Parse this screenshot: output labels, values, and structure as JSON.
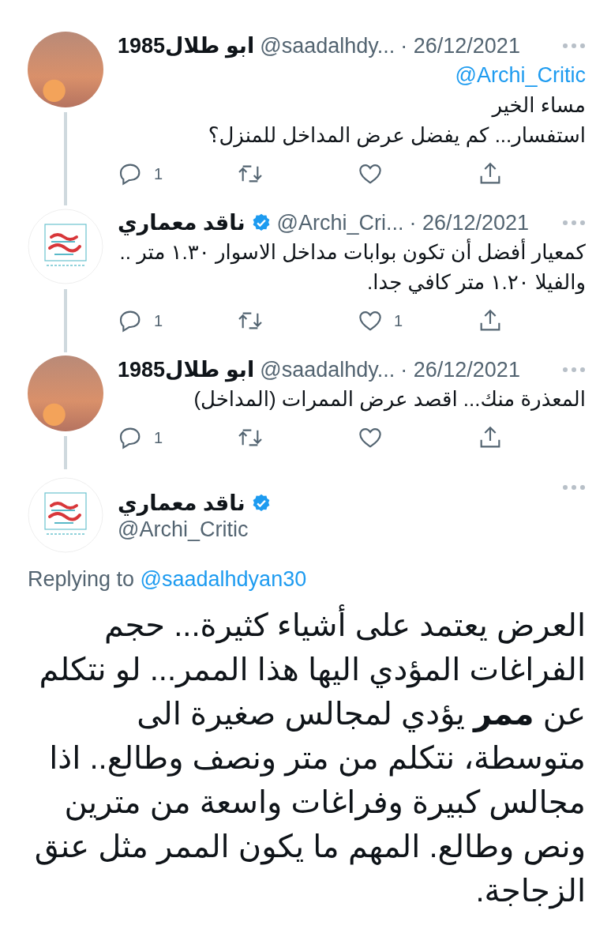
{
  "thread": [
    {
      "avatar": {
        "kind": "photo"
      },
      "name": "ابو طلال1985",
      "verified": false,
      "handle": "@saadalhdy...",
      "date": "· 26/12/2021",
      "mention": "@Archi_Critic",
      "lines": [
        "مساء الخير",
        "استفسار... كم يفضل عرض المداخل للمنزل؟"
      ],
      "reply_count": "1"
    },
    {
      "avatar": {
        "kind": "logo"
      },
      "name": "ناقد معماري",
      "verified": true,
      "handle": "@Archi_Cri...",
      "date": "· 26/12/2021",
      "lines": [
        "كمعيار أفضل أن تكون بوابات مداخل الاسوار ١.٣٠ متر .. والفيلا ١.٢٠ متر كافي جدا."
      ],
      "reply_count": "1",
      "like_count": "1"
    },
    {
      "avatar": {
        "kind": "photo"
      },
      "name": "ابو طلال1985",
      "verified": false,
      "handle": "@saadalhdy...",
      "date": "· 26/12/2021",
      "lines": [
        "المعذرة منك... اقصد عرض الممرات (المداخل)"
      ],
      "reply_count": "1"
    }
  ],
  "main": {
    "avatar": {
      "kind": "logo"
    },
    "name": "ناقد معماري",
    "verified": true,
    "handle": "@Archi_Critic",
    "replying_prefix": "Replying to",
    "replying_handle": "@saadalhdyan30",
    "text": "العرض يعتمد على أشياء كثيرة... حجم الفراغات المؤدي اليها هذا الممر... لو نتكلم عن **ممر** يؤدي لمجالس صغيرة الى متوسطة، نتكلم من متر ونصف وطالع.. اذا مجالس كبيرة وفراغات واسعة من مترين ونص وطالع. المهم ما يكون الممر مثل عنق الزجاجة."
  }
}
